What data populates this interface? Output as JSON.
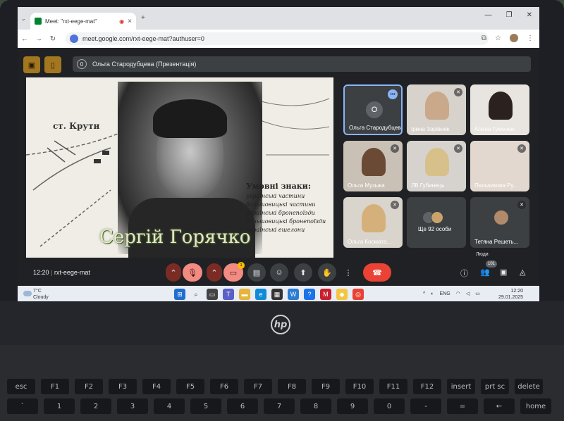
{
  "browser": {
    "tab_title": "Meet: \"rxt-eege-mat\"",
    "url": "meet.google.com/rxt-eege-mat?authuser=0",
    "new_tab_symbol": "+",
    "close_symbol": "×"
  },
  "meet": {
    "presentation_count": "0",
    "presenter_banner": "Ольга Стародубцева (Презентація)",
    "slide": {
      "map_label": "ст. Крути",
      "legend_title": "Умовні знаки:",
      "legend_items": [
        "українські частини",
        "большовицькі частини",
        "українські бронепоїзди",
        "большовицькі бронепоїзди",
        "українські ешелони"
      ],
      "caption": "Сергій Горячко"
    },
    "participants": [
      {
        "name": "Ольга Стародубцева",
        "initial": "О",
        "muted": false,
        "active": true
      },
      {
        "name": "Ірина Зарівняк",
        "muted": true
      },
      {
        "name": "Алена Гуменюк",
        "muted": false
      },
      {
        "name": "Ольга Музыка",
        "muted": true
      },
      {
        "name": "ЛВ Губинець",
        "muted": true
      },
      {
        "name": "Пальчикова Ру...",
        "muted": true
      },
      {
        "name": "Ольга Космата...",
        "muted": true
      },
      {
        "name": "Ще 92 особи",
        "muted": false
      },
      {
        "name": "Тетяна Решеть...",
        "muted": true
      }
    ],
    "more_symbol": "•••"
  },
  "controls": {
    "time": "12:20",
    "meeting_code": "rxt-eege-mat",
    "camera_badge": "1",
    "people_tooltip": "Люди",
    "people_count": "101"
  },
  "taskbar": {
    "temperature": "7°C",
    "condition": "Cloudy",
    "language": "ENG",
    "time": "12:20",
    "date": "29.01.2025"
  },
  "brand": {
    "logo_text": "hp"
  },
  "keyboard": {
    "row1": [
      "esc",
      "F1",
      "F2",
      "F3",
      "F4",
      "F5",
      "F6",
      "F7",
      "F8",
      "F9",
      "F10",
      "F11",
      "F12",
      "insert",
      "prt sc",
      "delete"
    ],
    "row2": [
      "`",
      "1",
      "2",
      "3",
      "4",
      "5",
      "6",
      "7",
      "8",
      "9",
      "0",
      "-",
      "=",
      "←",
      "home"
    ]
  },
  "colors": {
    "meet_bg": "#202124",
    "end_call": "#ea4335",
    "active_tile_border": "#8ab4f8",
    "presenting_btn": "#a27720"
  }
}
